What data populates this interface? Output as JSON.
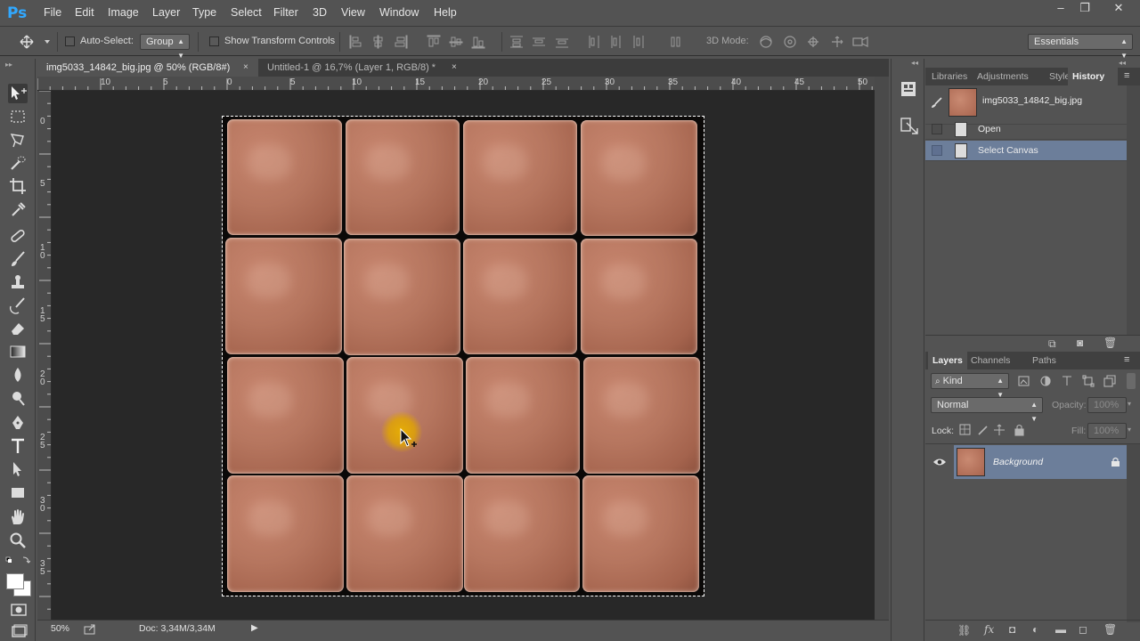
{
  "app": {
    "logo": "Ps"
  },
  "menu": [
    "File",
    "Edit",
    "Image",
    "Layer",
    "Type",
    "Select",
    "Filter",
    "3D",
    "View",
    "Window",
    "Help"
  ],
  "window_controls": {
    "minimize": "‒",
    "restore": "❐",
    "close": "✕"
  },
  "options_bar": {
    "auto_select_label": "Auto-Select:",
    "auto_select_value": "Group",
    "show_transform_label": "Show Transform Controls",
    "mode_3d_label": "3D Mode:",
    "workspace": "Essentials"
  },
  "document_tabs": [
    {
      "label": "img5033_14842_big.jpg @ 50% (RGB/8#)",
      "active": true,
      "close": "×"
    },
    {
      "label": "Untitled-1 @ 16,7% (Layer 1, RGB/8) *",
      "active": false,
      "close": "×"
    }
  ],
  "ruler": {
    "horizontal": [
      "10",
      "5",
      "0",
      "5",
      "10",
      "15",
      "20",
      "25",
      "30",
      "35",
      "40",
      "45",
      "50"
    ],
    "vertical": [
      "0",
      "5",
      "1\n0",
      "1\n5",
      "2\n0",
      "2\n5",
      "3\n0",
      "3\n5"
    ]
  },
  "canvas": {
    "tile_grid": {
      "rows": 4,
      "cols": 4
    },
    "selection": "marching-ants"
  },
  "status_bar": {
    "zoom": "50%",
    "doc": "Doc: 3,34M/3,34M"
  },
  "history_panel": {
    "tabs": [
      {
        "label": "Libraries",
        "active": false
      },
      {
        "label": "Adjustments",
        "active": false
      },
      {
        "label": "Styles",
        "active": false
      },
      {
        "label": "History",
        "active": true
      }
    ],
    "snapshot_name": "img5033_14842_big.jpg",
    "states": [
      {
        "label": "Open",
        "selected": false
      },
      {
        "label": "Select Canvas",
        "selected": true
      }
    ]
  },
  "layers_panel": {
    "tabs": [
      {
        "label": "Layers",
        "active": true
      },
      {
        "label": "Channels",
        "active": false
      },
      {
        "label": "Paths",
        "active": false
      }
    ],
    "filter_kind": "Kind",
    "blend_mode": "Normal",
    "opacity_label": "Opacity:",
    "opacity_value": "100%",
    "lock_label": "Lock:",
    "fill_label": "Fill:",
    "fill_value": "100%",
    "layers": [
      {
        "name": "Background",
        "visible": true,
        "locked": true
      }
    ]
  },
  "colors": {
    "accent_selection": "#6c7e9a",
    "ps_logo": "#31a8ff",
    "canvas_bg": "#282828",
    "tile": "#b6765f"
  }
}
